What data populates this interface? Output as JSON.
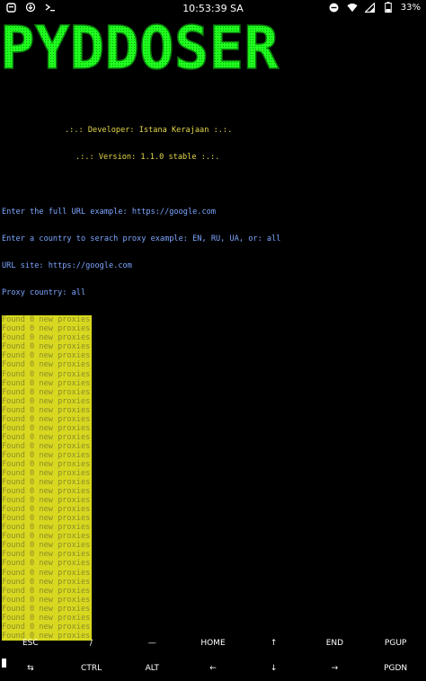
{
  "status_bar": {
    "time": "10:53:39 SA",
    "battery": "33%",
    "left_icons": [
      "notification-icon",
      "download-icon",
      "terminal-icon"
    ],
    "right_icons": [
      "dnd-icon",
      "wifi-icon",
      "signal-icon",
      "battery-icon"
    ]
  },
  "banner": {
    "text": "PYDDOSER",
    "color": "#22ff22"
  },
  "terminal": {
    "credits": [
      ".:.: Developer: Istana Kerajaan :.:.",
      ".:.: Version: 1.1.0 stable :.:."
    ],
    "prompt_url": "Enter the full URL example: https://google.com",
    "prompt_country": "Enter a country to serach proxy example: EN, RU, UA, or: all",
    "url_site": "URL site: https://google.com",
    "proxy_country": "Proxy country: all",
    "proxy_message": "Found 0 new proxies",
    "proxy_message_count": 36
  },
  "extra_keys": {
    "row1": [
      "ESC",
      "/",
      "—",
      "HOME",
      "↑",
      "END",
      "PGUP"
    ],
    "row2": [
      "⇆",
      "CTRL",
      "ALT",
      "←",
      "↓",
      "→",
      "PGDN"
    ]
  },
  "colors": {
    "background": "#000000",
    "banner": "#22ff22",
    "credit": "#e5d84a",
    "prompt": "#7da6ff",
    "highlight": "#d8d820"
  }
}
